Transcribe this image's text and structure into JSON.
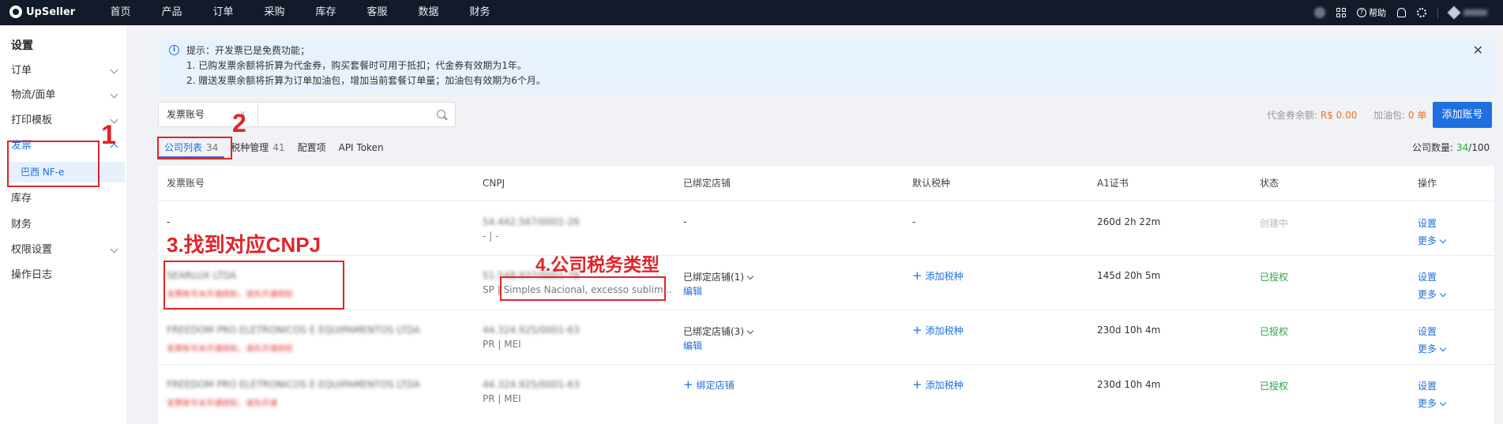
{
  "topbar": {
    "brand": "UpSeller",
    "nav": [
      "首页",
      "产品",
      "订单",
      "采购",
      "库存",
      "客服",
      "数据",
      "财务"
    ],
    "help_label": "帮助"
  },
  "sidebar": {
    "title": "设置",
    "items": [
      {
        "label": "订单",
        "expandable": true
      },
      {
        "label": "物流/面单",
        "expandable": true
      },
      {
        "label": "打印模板",
        "expandable": true
      },
      {
        "label": "发票",
        "expandable": true,
        "expanded": true
      },
      {
        "label": "库存",
        "expandable": false
      },
      {
        "label": "财务",
        "expandable": false
      },
      {
        "label": "权限设置",
        "expandable": true
      },
      {
        "label": "操作日志",
        "expandable": false
      }
    ],
    "sub_active": "巴西 NF-e"
  },
  "notice": {
    "line1": "提示：开发票已是免费功能；",
    "line2": "1. 已购发票余额将折算为代金券，购买套餐时可用于抵扣；代金券有效期为1年。",
    "line3": "2. 赠送发票余额将折算为订单加油包，增加当前套餐订单量；加油包有效期为6个月。"
  },
  "search": {
    "select_value": "发票账号",
    "placeholder": ""
  },
  "balances": {
    "voucher_label": "代金券余额:",
    "voucher_value": "R$ 0.00",
    "boost_label": "加油包:",
    "boost_value": "0 单"
  },
  "add_button": "添加账号",
  "tabs": [
    {
      "label": "公司列表",
      "count": "34",
      "active": true
    },
    {
      "label": "税种管理",
      "count": "41",
      "active": false
    },
    {
      "label": "配置项",
      "count": "",
      "active": false
    },
    {
      "label": "API Token",
      "count": "",
      "active": false
    }
  ],
  "company_count": {
    "label": "公司数量:",
    "value": "34",
    "total": "/100"
  },
  "table": {
    "headers": [
      "发票账号",
      "CNPJ",
      "已绑定店铺",
      "默认税种",
      "A1证书",
      "状态",
      "操作"
    ],
    "rows": [
      {
        "account": "-",
        "account_sub": "",
        "cnpj": "54.442.567/0001-26",
        "cnpj_sub": "- | -",
        "store": "-",
        "store_edit": "",
        "tax": "-",
        "cert": "260d 2h 22m",
        "status": "创建中",
        "status_type": "creating",
        "op_settings": "设置",
        "op_more": "更多"
      },
      {
        "account": "SEARLUX LTDA",
        "account_sub": "发票账号未开通授权，请先开通授权",
        "cnpj": "51.548.937/0001-78",
        "cnpj_sub_state": "SP",
        "cnpj_sub_type": "Simples Nacional, excesso sublim...",
        "store": "已绑定店铺(1)",
        "store_edit": "编辑",
        "tax": "添加税种",
        "cert": "145d 20h 5m",
        "status": "已授权",
        "status_type": "ok",
        "op_settings": "设置",
        "op_more": "更多"
      },
      {
        "account": "FREEDOM PRO ELETRONICOS E EQUIPAMENTOS LTDA",
        "account_sub": "发票账号未开通授权，请先开通授权",
        "cnpj": "44.324.925/0001-63",
        "cnpj_sub": "PR | MEI",
        "store": "已绑定店铺(3)",
        "store_edit": "编辑",
        "tax": "添加税种",
        "cert": "230d 10h 4m",
        "status": "已授权",
        "status_type": "ok",
        "op_settings": "设置",
        "op_more": "更多"
      },
      {
        "account": "FREEDOM PRO ELETRONICOS E EQUIPAMENTOS LTDA",
        "account_sub": "发票账号未开通授权，请先开通",
        "cnpj": "44.324.925/0001-63",
        "cnpj_sub": "PR | MEI",
        "store": "绑定店铺",
        "store_edit": "",
        "tax": "添加税种",
        "cert": "230d 10h 4m",
        "status": "已授权",
        "status_type": "ok",
        "op_settings": "设置",
        "op_more": "更多"
      }
    ]
  },
  "annotations": {
    "step1": "1",
    "step2": "2",
    "step3": "3.找到对应CNPJ",
    "step4": "4.公司税务类型"
  }
}
